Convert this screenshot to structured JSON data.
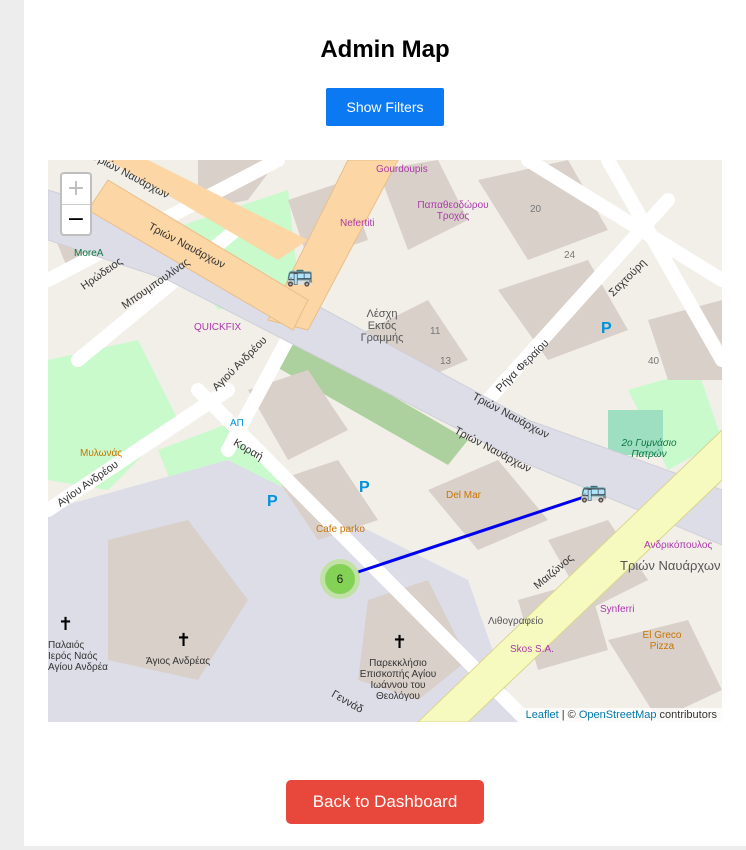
{
  "page": {
    "title": "Admin Map",
    "show_filters_label": "Show Filters",
    "back_label": "Back to Dashboard"
  },
  "map": {
    "zoom_in": "+",
    "zoom_out": "−",
    "attribution": {
      "leaflet": "Leaflet",
      "separator": " | © ",
      "osm": "OpenStreetMap",
      "suffix": " contributors"
    },
    "cluster_count": "6",
    "route_color": "#0000ee",
    "bus_icon": "bus-icon",
    "streets": [
      "Τριών Ναυάρχων",
      "Τριών Ναυάρχων",
      "Τριών Ναυάρχων",
      "Τριών Ναυάρχων",
      "Τριών Ναυάρχων",
      "Ηρώδειος",
      "Μπουμπουλίνας",
      "Αγιού Ανδρέου",
      "Κοραή",
      "Αγίου Ανδρέου",
      "Ρήγα Φεραίου",
      "Σαχτούρη",
      "Μαιζώνος",
      "Γεννάδ"
    ],
    "places": [
      "Gourdoupis",
      "Παπαθεοδώρου Τροχός",
      "Nefertiti",
      "QUICKFIX",
      "Λέσχη Εκτός Γραμμής",
      "Μυλωνάς",
      "ΑΠ",
      "Cafe parko",
      "Del Mar",
      "2ο Γυμνάσιο Πατρών",
      "Λιθογραφείο",
      "Skos S.A.",
      "Synferri",
      "El Greco Pizza",
      "Ανδρικόπουλος",
      "Άγιος Ανδρέας",
      "Παλαιός Ιερός Ναός Αγίου Ανδρέα",
      "Παρεκκλήσιο Επισκοπής Αγίου Ιωάννου του Θεολόγου",
      "MoreA"
    ],
    "numbers": [
      "20",
      "24",
      "11",
      "13",
      "40"
    ],
    "parking": "P"
  }
}
